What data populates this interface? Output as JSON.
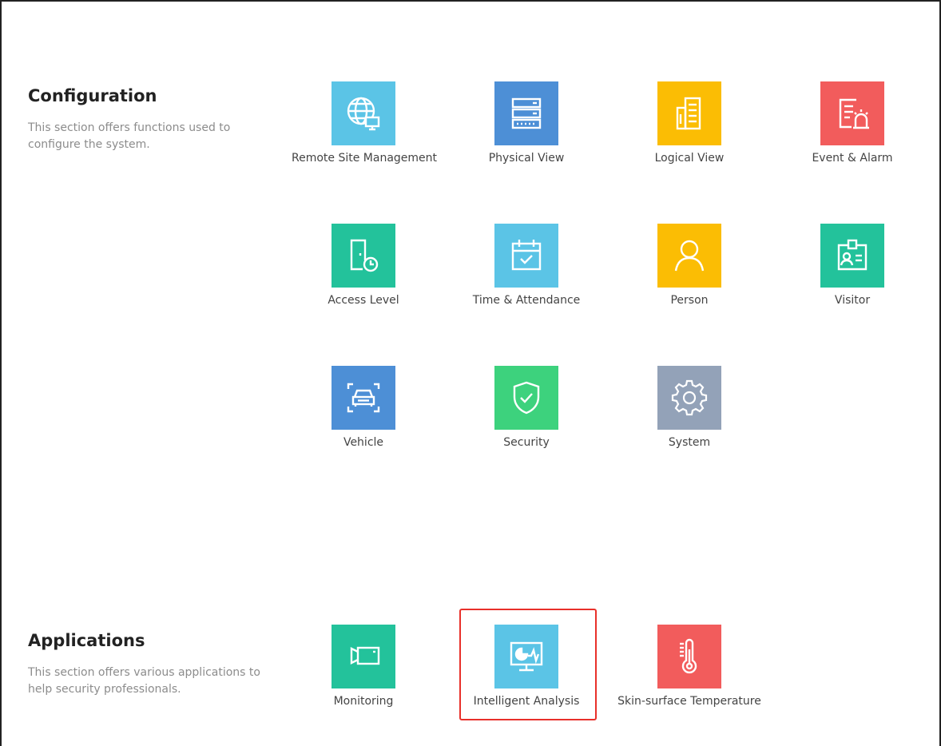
{
  "configuration": {
    "title": "Configuration",
    "description": "This section offers functions used to configure the system.",
    "tiles": [
      {
        "label": "Remote Site Management",
        "icon": "globe-icon",
        "color": "#5bc4e6"
      },
      {
        "label": "Physical View",
        "icon": "server-icon",
        "color": "#4d8fd6"
      },
      {
        "label": "Logical View",
        "icon": "buildings-icon",
        "color": "#fbbd04"
      },
      {
        "label": "Event & Alarm",
        "icon": "alarm-icon",
        "color": "#f25c5c"
      },
      {
        "label": "Access Level",
        "icon": "door-clock-icon",
        "color": "#23c29b"
      },
      {
        "label": "Time & Attendance",
        "icon": "calendar-icon",
        "color": "#5bc4e6"
      },
      {
        "label": "Person",
        "icon": "person-icon",
        "color": "#fbbd04"
      },
      {
        "label": "Visitor",
        "icon": "visitor-badge-icon",
        "color": "#23c29b"
      },
      {
        "label": "Vehicle",
        "icon": "car-icon",
        "color": "#4d8fd6"
      },
      {
        "label": "Security",
        "icon": "shield-check-icon",
        "color": "#3dd27d"
      },
      {
        "label": "System",
        "icon": "gear-icon",
        "color": "#93a2b8"
      }
    ]
  },
  "applications": {
    "title": "Applications",
    "description": "This section offers various applications to help security professionals.",
    "tiles": [
      {
        "label": "Monitoring",
        "icon": "camera-icon",
        "color": "#23c29b"
      },
      {
        "label": "Intelligent Analysis",
        "icon": "monitor-chart-icon",
        "color": "#5bc4e6"
      },
      {
        "label": "Skin-surface Temperature",
        "icon": "thermometer-icon",
        "color": "#f25c5c"
      }
    ]
  },
  "highlight_color": "#e8302a"
}
